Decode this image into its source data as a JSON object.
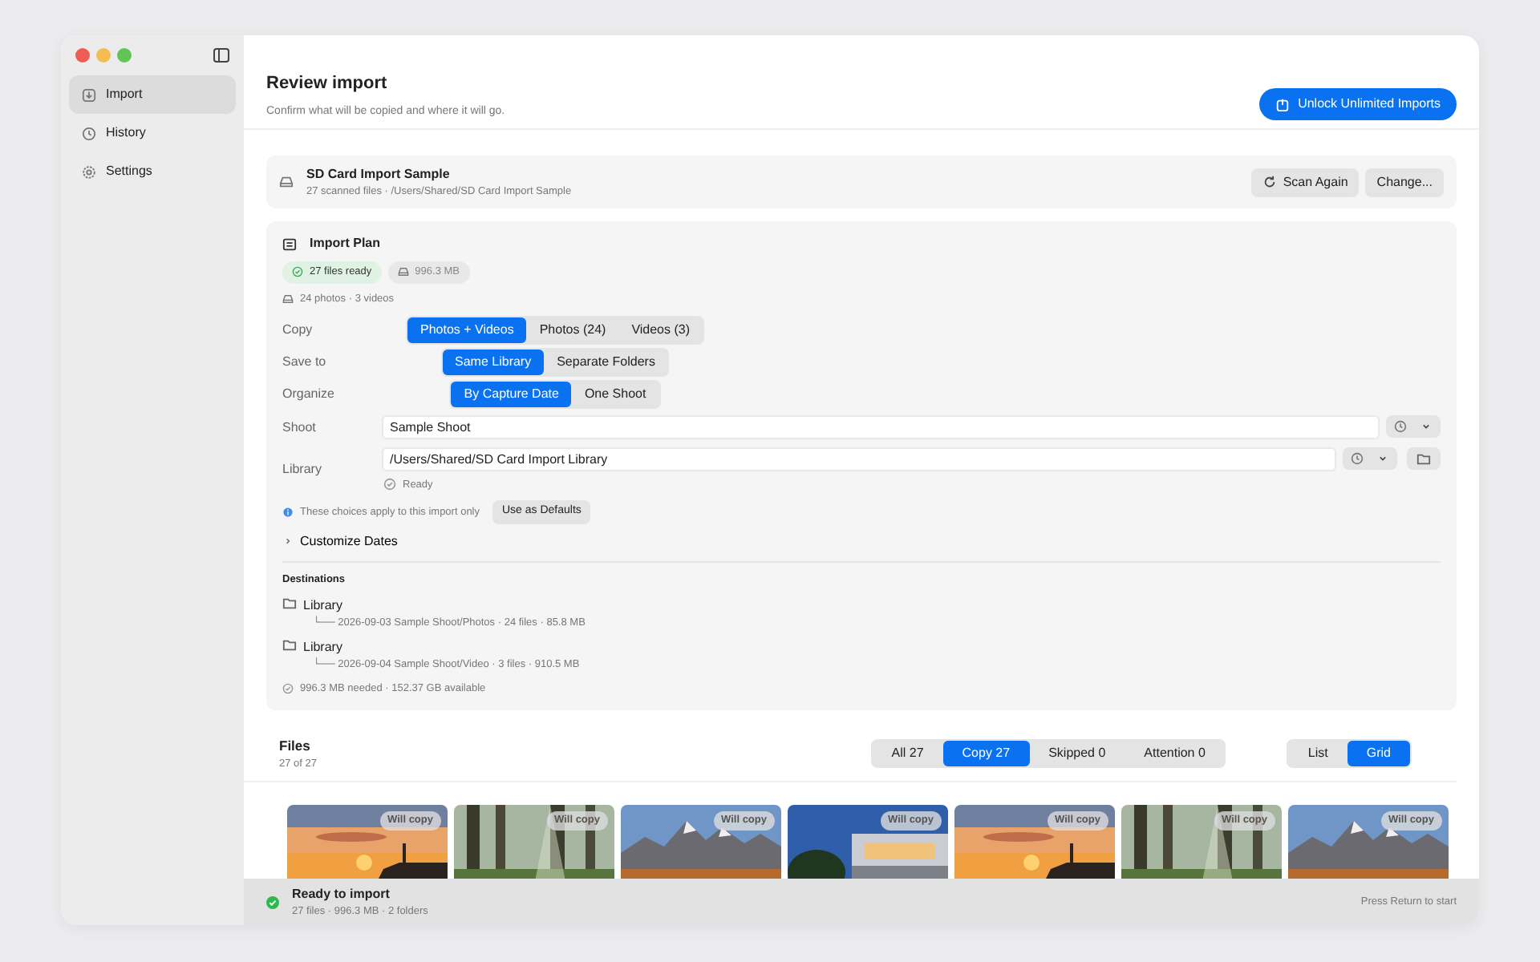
{
  "sidebar": {
    "items": [
      {
        "label": "Import",
        "selected": true
      },
      {
        "label": "History",
        "selected": false
      },
      {
        "label": "Settings",
        "selected": false
      }
    ]
  },
  "header": {
    "title": "Review import",
    "subtitle": "Confirm what will be copied and where it will go.",
    "action": "Unlock Unlimited Imports"
  },
  "source": {
    "name": "SD Card Import Sample",
    "details": "27 scanned files · /Users/Shared/SD Card Import Sample",
    "buttons": [
      "Scan Again",
      "Change..."
    ]
  },
  "plan": {
    "title": "Import Plan",
    "badges": [
      {
        "label": "27 files ready",
        "kind": "ready"
      },
      {
        "label": "996.3 MB",
        "kind": "size"
      }
    ],
    "summary": "24 photos · 3 videos",
    "choices": [
      {
        "label": "Copy",
        "options": [
          {
            "label": "Photos + Videos",
            "selected": true
          },
          {
            "label": "Photos (24)",
            "selected": false
          },
          {
            "label": "Videos (3)",
            "selected": false
          }
        ]
      },
      {
        "label": "Save to",
        "options": [
          {
            "label": "Same Library",
            "selected": true
          },
          {
            "label": "Separate Folders",
            "selected": false
          }
        ]
      },
      {
        "label": "Organize",
        "options": [
          {
            "label": "By Capture Date",
            "selected": true
          },
          {
            "label": "One Shoot",
            "selected": false
          }
        ]
      }
    ],
    "shoot": {
      "label": "Shoot",
      "value": "Sample Shoot"
    },
    "library": {
      "label": "Library",
      "value": "/Users/Shared/SD Card Import Library",
      "status": "Ready"
    },
    "note": "These choices apply to this import only",
    "note_button": "Use as Defaults",
    "disclosure": {
      "label": "Customize Dates",
      "expanded": false
    },
    "destinations_title": "Destinations",
    "destinations": [
      {
        "name": "Library",
        "path": "└── 2026-09-03 Sample Shoot/Photos · 24 files · 85.8 MB"
      },
      {
        "name": "Library",
        "path": "└── 2026-09-04 Sample Shoot/Video · 3 files · 910.5 MB"
      }
    ],
    "space": "996.3 MB needed · 152.37 GB available"
  },
  "files": {
    "title": "Files",
    "count": "27 of 27",
    "filters": [
      {
        "label": "All 27",
        "selected": false
      },
      {
        "label": "Copy 27",
        "selected": true
      },
      {
        "label": "Skipped 0",
        "selected": false
      },
      {
        "label": "Attention 0",
        "selected": false
      }
    ],
    "views": [
      {
        "label": "List",
        "selected": false
      },
      {
        "label": "Grid",
        "selected": true
      }
    ],
    "thumbnails": [
      {
        "badge": "Will copy"
      },
      {
        "badge": "Will copy"
      },
      {
        "badge": "Will copy"
      },
      {
        "badge": "Will copy"
      },
      {
        "badge": "Will copy"
      },
      {
        "badge": "Will copy"
      },
      {
        "badge": "Will copy"
      }
    ]
  },
  "status_bar": {
    "title": "Ready to import",
    "details": "27 files · 996.3 MB · 2 folders",
    "hint": "Press Return to start"
  }
}
